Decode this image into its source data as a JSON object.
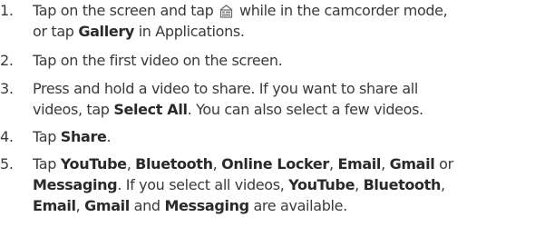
{
  "steps": [
    {
      "number": "1.",
      "line1_a": "Tap on the screen and tap ",
      "icon": "camcorder-gallery-icon",
      "line1_b": " while in the camcorder mode,",
      "line2_a": "or tap ",
      "gallery": "Gallery",
      "line2_b": " in Applications."
    },
    {
      "number": "2.",
      "text": "Tap on the first video on the screen."
    },
    {
      "number": "3.",
      "line1": "Press and hold a video to share. If you want to share all",
      "line2_a": "videos, tap ",
      "select_all": "Select All",
      "line2_b": ". You can also select a few videos."
    },
    {
      "number": "4.",
      "text_a": "Tap ",
      "share": "Share",
      "text_b": "."
    },
    {
      "number": "5.",
      "tap": "Tap ",
      "youtube": "YouTube",
      "comma1": ", ",
      "bluetooth": "Bluetooth",
      "comma2": ", ",
      "online_locker": "Online Locker",
      "comma3": ", ",
      "email": "Email",
      "comma4": ", ",
      "gmail": "Gmail",
      "or": " or",
      "messaging": "Messaging",
      "mid": ". If you select all videos, ",
      "youtube2": "YouTube",
      "comma5": ", ",
      "bluetooth2": "Bluetooth",
      "comma6": ",",
      "email2": "Email",
      "comma7": ", ",
      "gmail2": "Gmail",
      "and": " and ",
      "messaging2": "Messaging",
      "end": " are available."
    }
  ]
}
